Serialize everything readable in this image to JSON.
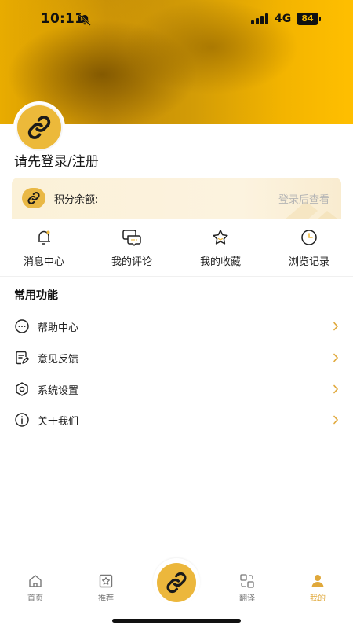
{
  "status": {
    "time": "10:11",
    "network": "4G",
    "battery": "84"
  },
  "profile": {
    "login_prompt": "请先登录/注册"
  },
  "points": {
    "label": "积分余额:",
    "hint": "登录后查看"
  },
  "quick_links": [
    {
      "label": "消息中心",
      "icon": "bell-icon"
    },
    {
      "label": "我的评论",
      "icon": "comment-icon"
    },
    {
      "label": "我的收藏",
      "icon": "star-icon"
    },
    {
      "label": "浏览记录",
      "icon": "clock-icon"
    }
  ],
  "common": {
    "title": "常用功能",
    "items": [
      {
        "label": "帮助中心",
        "icon": "dots-chat-icon"
      },
      {
        "label": "意见反馈",
        "icon": "feedback-icon"
      },
      {
        "label": "系统设置",
        "icon": "settings-icon"
      },
      {
        "label": "关于我们",
        "icon": "info-icon"
      }
    ]
  },
  "tabs": [
    {
      "label": "首页",
      "icon": "home-icon"
    },
    {
      "label": "推荐",
      "icon": "recommend-icon"
    },
    {
      "label": "翻译",
      "icon": "translate-icon"
    },
    {
      "label": "我的",
      "icon": "profile-icon",
      "active": true
    }
  ],
  "colors": {
    "accent": "#e0a83a",
    "brand_yellow": "#ffbf00"
  }
}
